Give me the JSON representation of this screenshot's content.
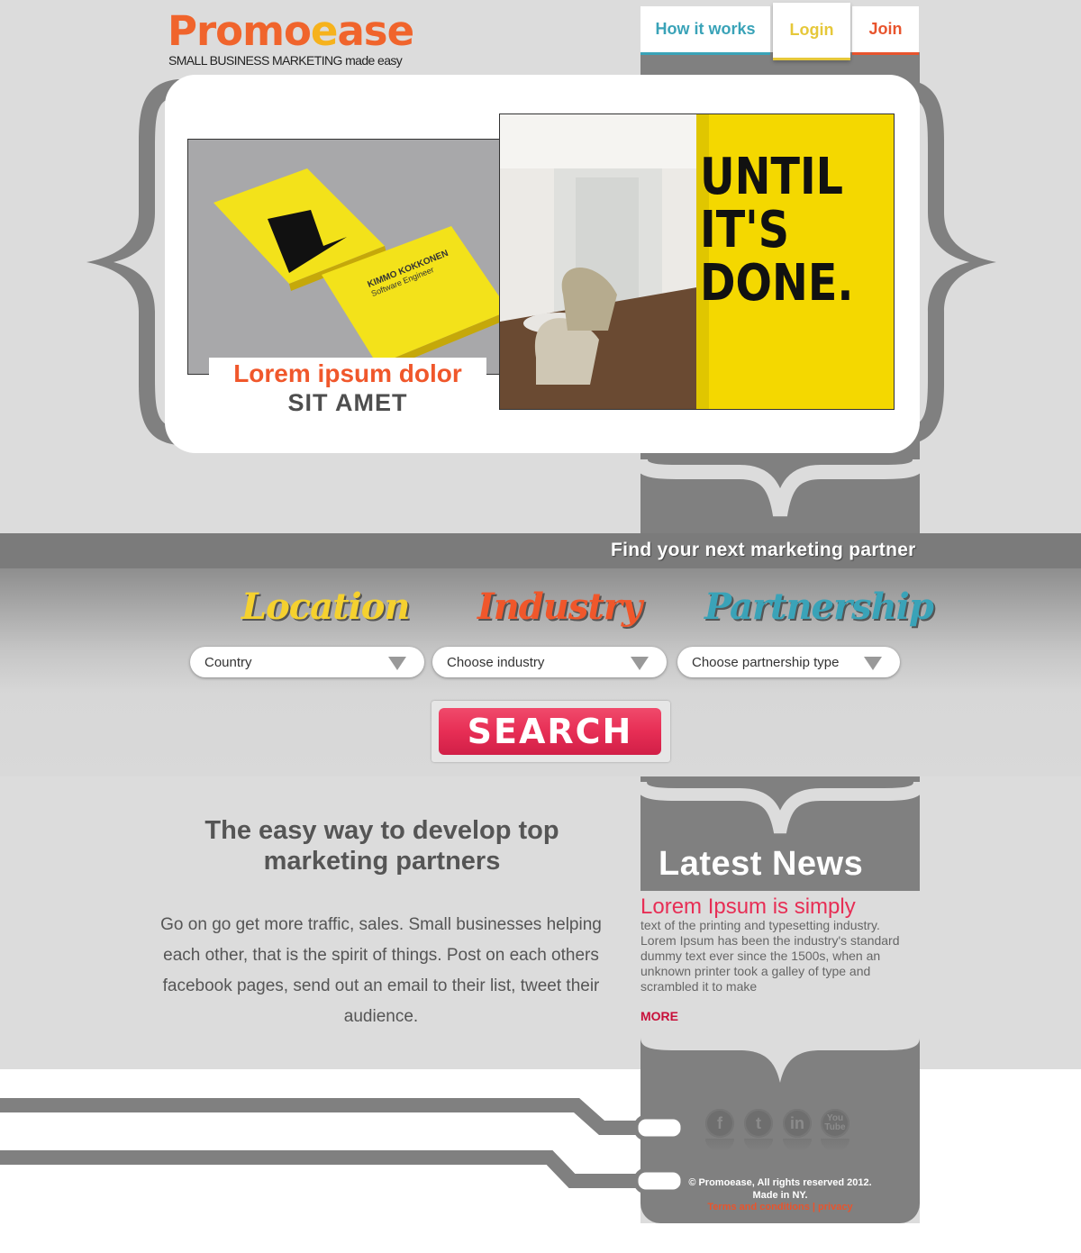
{
  "brand": {
    "logo_part1": "Promo",
    "logo_part2": "e",
    "logo_part3": "ase",
    "tagline_caps": "SMALL BUSINESS MARKETING",
    "tagline_tail": " made easy"
  },
  "nav": {
    "how": "How it works",
    "login": "Login",
    "join": "Join"
  },
  "hero": {
    "caption_line1": "Lorem ipsum dolor",
    "caption_line2": "SIT AMET",
    "card_name": "KIMMO KOKKONEN",
    "card_role": "Software Engineer",
    "wall_line1": "UNTIL",
    "wall_line2": "IT'S",
    "wall_line3": "DONE."
  },
  "search": {
    "title": "Find your next marketing partner",
    "location_label": "Location",
    "industry_label": "Industry",
    "partnership_label": "Partnership",
    "country_value": "Country",
    "industry_value": "Choose industry",
    "partnership_value": "Choose partnership type",
    "button": "SEARCH"
  },
  "intro": {
    "title": "The easy way to develop top marketing partners",
    "body": "Go on go get more traffic, sales. Small businesses helping each other, that is the spirit of things. Post on each others facebook pages, send out an email to their list, tweet their audience."
  },
  "news": {
    "title": "Latest News",
    "headline": "Lorem Ipsum is simply",
    "body": "text of the printing and typesetting industry. Lorem Ipsum has been the industry's standard dummy text ever since the 1500s, when an unknown printer took a galley of type and scrambled it to make",
    "more": "MORE"
  },
  "footer": {
    "copyright": "© Promoease, All rights reserved 2012.",
    "made_in": "Made in NY.",
    "links": "Terms and conditions | privacy",
    "social_fb": "f",
    "social_tw": "t",
    "social_in": "in",
    "social_yt": "You Tube"
  },
  "colors": {
    "orange": "#f0642c",
    "yellow": "#f6b21c",
    "teal": "#3aa3b8",
    "red": "#e72e55",
    "gray": "#808080"
  }
}
